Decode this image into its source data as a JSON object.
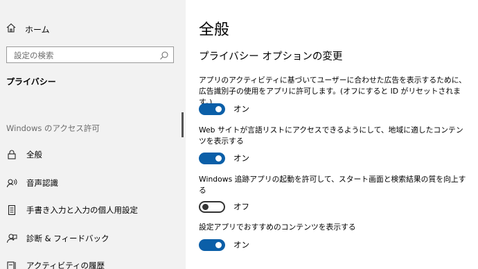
{
  "sidebar": {
    "home_label": "ホーム",
    "search_placeholder": "設定の検索",
    "category_title": "プライバシー",
    "section_label": "Windows のアクセス許可",
    "items": [
      {
        "label": "全般",
        "icon": "lock-icon"
      },
      {
        "label": "音声認識",
        "icon": "speech-icon"
      },
      {
        "label": "手書き入力と入力の個人用設定",
        "icon": "handwriting-icon"
      },
      {
        "label": "診断 & フィードバック",
        "icon": "feedback-icon"
      },
      {
        "label": "アクティビティの履歴",
        "icon": "activity-history-icon"
      }
    ]
  },
  "main": {
    "title": "全般",
    "subtitle": "プライバシー オプションの変更",
    "options": [
      {
        "description": "アプリのアクティビティに基づいてユーザーに合わせた広告を表示するために、広告識別子の使用をアプリに許可します。(オフにすると ID がリセットされます。)",
        "state": "オン",
        "on": true
      },
      {
        "description": "Web サイトが言語リストにアクセスできるようにして、地域に適したコンテンツを表示する",
        "state": "オン",
        "on": true
      },
      {
        "description": "Windows 追跡アプリの起動を許可して、スタート画面と検索結果の質を向上する",
        "state": "オフ",
        "on": false
      },
      {
        "description": "設定アプリでおすすめのコンテンツを表示する",
        "state": "オン",
        "on": true
      }
    ]
  },
  "colors": {
    "toggle_on": "#0b5fa8",
    "sidebar_bg": "#f2f2f2"
  }
}
